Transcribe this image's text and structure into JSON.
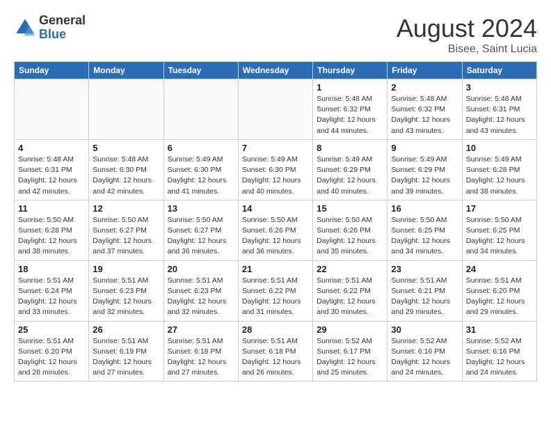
{
  "header": {
    "logo_general": "General",
    "logo_blue": "Blue",
    "month_title": "August 2024",
    "location": "Bisee, Saint Lucia"
  },
  "days_of_week": [
    "Sunday",
    "Monday",
    "Tuesday",
    "Wednesday",
    "Thursday",
    "Friday",
    "Saturday"
  ],
  "weeks": [
    [
      {
        "day": "",
        "info": ""
      },
      {
        "day": "",
        "info": ""
      },
      {
        "day": "",
        "info": ""
      },
      {
        "day": "",
        "info": ""
      },
      {
        "day": "1",
        "info": "Sunrise: 5:48 AM\nSunset: 6:32 PM\nDaylight: 12 hours\nand 44 minutes."
      },
      {
        "day": "2",
        "info": "Sunrise: 5:48 AM\nSunset: 6:32 PM\nDaylight: 12 hours\nand 43 minutes."
      },
      {
        "day": "3",
        "info": "Sunrise: 5:48 AM\nSunset: 6:31 PM\nDaylight: 12 hours\nand 43 minutes."
      }
    ],
    [
      {
        "day": "4",
        "info": "Sunrise: 5:48 AM\nSunset: 6:31 PM\nDaylight: 12 hours\nand 42 minutes."
      },
      {
        "day": "5",
        "info": "Sunrise: 5:48 AM\nSunset: 6:30 PM\nDaylight: 12 hours\nand 42 minutes."
      },
      {
        "day": "6",
        "info": "Sunrise: 5:49 AM\nSunset: 6:30 PM\nDaylight: 12 hours\nand 41 minutes."
      },
      {
        "day": "7",
        "info": "Sunrise: 5:49 AM\nSunset: 6:30 PM\nDaylight: 12 hours\nand 40 minutes."
      },
      {
        "day": "8",
        "info": "Sunrise: 5:49 AM\nSunset: 6:29 PM\nDaylight: 12 hours\nand 40 minutes."
      },
      {
        "day": "9",
        "info": "Sunrise: 5:49 AM\nSunset: 6:29 PM\nDaylight: 12 hours\nand 39 minutes."
      },
      {
        "day": "10",
        "info": "Sunrise: 5:49 AM\nSunset: 6:28 PM\nDaylight: 12 hours\nand 38 minutes."
      }
    ],
    [
      {
        "day": "11",
        "info": "Sunrise: 5:50 AM\nSunset: 6:28 PM\nDaylight: 12 hours\nand 38 minutes."
      },
      {
        "day": "12",
        "info": "Sunrise: 5:50 AM\nSunset: 6:27 PM\nDaylight: 12 hours\nand 37 minutes."
      },
      {
        "day": "13",
        "info": "Sunrise: 5:50 AM\nSunset: 6:27 PM\nDaylight: 12 hours\nand 36 minutes."
      },
      {
        "day": "14",
        "info": "Sunrise: 5:50 AM\nSunset: 6:26 PM\nDaylight: 12 hours\nand 36 minutes."
      },
      {
        "day": "15",
        "info": "Sunrise: 5:50 AM\nSunset: 6:26 PM\nDaylight: 12 hours\nand 35 minutes."
      },
      {
        "day": "16",
        "info": "Sunrise: 5:50 AM\nSunset: 6:25 PM\nDaylight: 12 hours\nand 34 minutes."
      },
      {
        "day": "17",
        "info": "Sunrise: 5:50 AM\nSunset: 6:25 PM\nDaylight: 12 hours\nand 34 minutes."
      }
    ],
    [
      {
        "day": "18",
        "info": "Sunrise: 5:51 AM\nSunset: 6:24 PM\nDaylight: 12 hours\nand 33 minutes."
      },
      {
        "day": "19",
        "info": "Sunrise: 5:51 AM\nSunset: 6:23 PM\nDaylight: 12 hours\nand 32 minutes."
      },
      {
        "day": "20",
        "info": "Sunrise: 5:51 AM\nSunset: 6:23 PM\nDaylight: 12 hours\nand 32 minutes."
      },
      {
        "day": "21",
        "info": "Sunrise: 5:51 AM\nSunset: 6:22 PM\nDaylight: 12 hours\nand 31 minutes."
      },
      {
        "day": "22",
        "info": "Sunrise: 5:51 AM\nSunset: 6:22 PM\nDaylight: 12 hours\nand 30 minutes."
      },
      {
        "day": "23",
        "info": "Sunrise: 5:51 AM\nSunset: 6:21 PM\nDaylight: 12 hours\nand 29 minutes."
      },
      {
        "day": "24",
        "info": "Sunrise: 5:51 AM\nSunset: 6:20 PM\nDaylight: 12 hours\nand 29 minutes."
      }
    ],
    [
      {
        "day": "25",
        "info": "Sunrise: 5:51 AM\nSunset: 6:20 PM\nDaylight: 12 hours\nand 28 minutes."
      },
      {
        "day": "26",
        "info": "Sunrise: 5:51 AM\nSunset: 6:19 PM\nDaylight: 12 hours\nand 27 minutes."
      },
      {
        "day": "27",
        "info": "Sunrise: 5:51 AM\nSunset: 6:18 PM\nDaylight: 12 hours\nand 27 minutes."
      },
      {
        "day": "28",
        "info": "Sunrise: 5:51 AM\nSunset: 6:18 PM\nDaylight: 12 hours\nand 26 minutes."
      },
      {
        "day": "29",
        "info": "Sunrise: 5:52 AM\nSunset: 6:17 PM\nDaylight: 12 hours\nand 25 minutes."
      },
      {
        "day": "30",
        "info": "Sunrise: 5:52 AM\nSunset: 6:16 PM\nDaylight: 12 hours\nand 24 minutes."
      },
      {
        "day": "31",
        "info": "Sunrise: 5:52 AM\nSunset: 6:16 PM\nDaylight: 12 hours\nand 24 minutes."
      }
    ]
  ]
}
